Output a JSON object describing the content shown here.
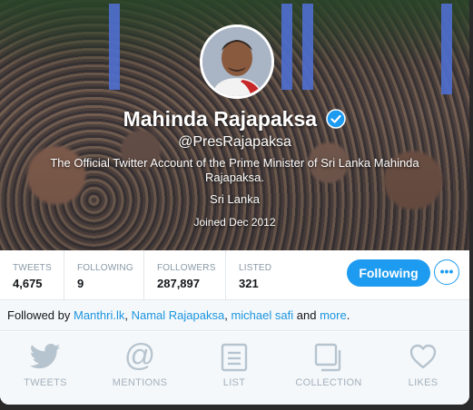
{
  "profile": {
    "name": "Mahinda Rajapaksa",
    "handle": "@PresRajapaksa",
    "bio": "The Official Twitter Account of the Prime Minister of Sri Lanka Mahinda Rajapaksa.",
    "location": "Sri Lanka",
    "joined": "Joined Dec 2012"
  },
  "stats": [
    {
      "label": "TWEETS",
      "value": "4,675"
    },
    {
      "label": "FOLLOWING",
      "value": "9"
    },
    {
      "label": "FOLLOWERS",
      "value": "287,897"
    },
    {
      "label": "LISTED",
      "value": "321"
    }
  ],
  "actions": {
    "following_label": "Following",
    "more_label": "•••"
  },
  "followed_by": {
    "prefix": "Followed by",
    "users": [
      "Manthri.lk",
      "Namal Rajapaksa",
      "michael safi"
    ],
    "sep": ",",
    "and": "and",
    "more": "more",
    "end": "."
  },
  "tabs": [
    {
      "label": "TWEETS",
      "icon": "bird-icon"
    },
    {
      "label": "MENTIONS",
      "icon": "at-icon"
    },
    {
      "label": "LIST",
      "icon": "list-icon"
    },
    {
      "label": "COLLECTION",
      "icon": "collection-icon"
    },
    {
      "label": "LIKES",
      "icon": "heart-icon"
    }
  ],
  "colors": {
    "accent": "#1d9bf0",
    "link": "#1b95e0",
    "tab_icon": "#b6c4cf"
  }
}
